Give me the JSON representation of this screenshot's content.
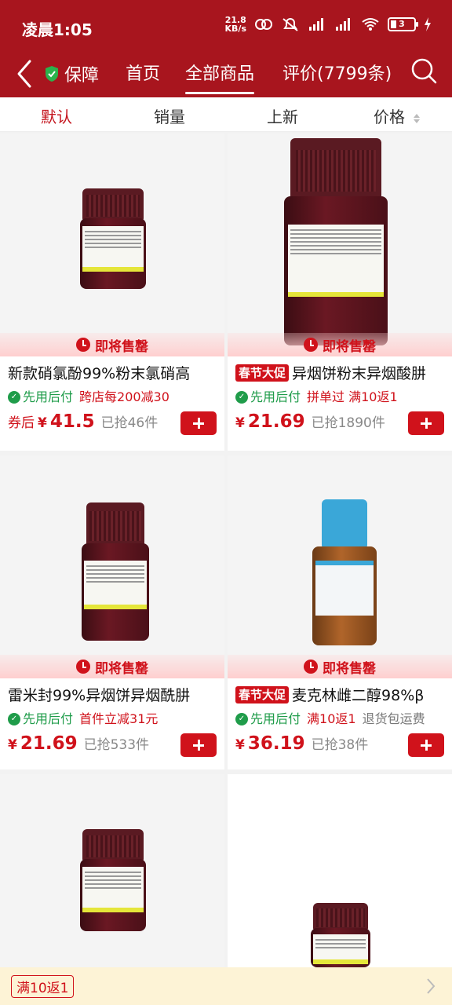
{
  "status_bar": {
    "time": "凌晨1:05",
    "net_speed_value": "21.8",
    "net_speed_unit": "KB/s",
    "battery": "3"
  },
  "nav": {
    "guarantee": "保障",
    "tabs": [
      {
        "label": "首页"
      },
      {
        "label": "全部商品"
      },
      {
        "label": "评价(7799条)"
      }
    ]
  },
  "sort": {
    "items": [
      {
        "label": "默认"
      },
      {
        "label": "销量"
      },
      {
        "label": "上新"
      },
      {
        "label": "价格"
      }
    ]
  },
  "products": [
    {
      "banner": "即将售罄",
      "title": "新款硝氯酚99%粉末氯硝高",
      "promo": "",
      "tag_green": "先用后付",
      "tag_red": "跨店每200减30",
      "tag_gray": "",
      "price_prefix": "券后",
      "currency": "¥",
      "price": "41.5",
      "sold": "已抢46件"
    },
    {
      "banner": "即将售罄",
      "title": "异烟饼粉末异烟酸肼",
      "promo": "春节大促",
      "tag_green": "先用后付",
      "tag_red": "拼单过  满10返1",
      "tag_gray": "",
      "price_prefix": "",
      "currency": "¥",
      "price": "21.69",
      "sold": "已抢1890件"
    },
    {
      "banner": "即将售罄",
      "title": "雷米封99%异烟饼异烟酰肼",
      "promo": "",
      "tag_green": "先用后付",
      "tag_red": "首件立减31元",
      "tag_gray": "",
      "price_prefix": "",
      "currency": "¥",
      "price": "21.69",
      "sold": "已抢533件"
    },
    {
      "banner": "即将售罄",
      "title": "麦克林雌二醇98%β",
      "promo": "春节大促",
      "tag_green": "先用后付",
      "tag_red": "满10返1",
      "tag_gray": "退货包运费",
      "price_prefix": "",
      "currency": "¥",
      "price": "36.19",
      "sold": "已抢38件"
    }
  ],
  "bottom_bar": {
    "coupon": "满10返1"
  },
  "colors": {
    "brand_red": "#a8151e",
    "price_red": "#d0121b",
    "green": "#1f9c4a"
  }
}
